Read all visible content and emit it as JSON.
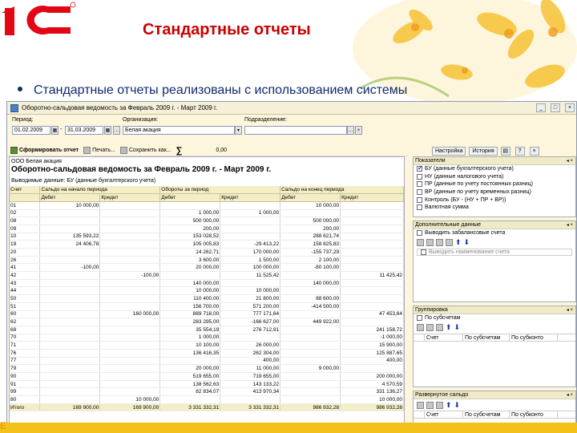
{
  "slide": {
    "title": "Стандартные отчеты",
    "bullet": "Стандартные отчеты реализованы с использованием системы",
    "bottom_letter": "E",
    "colors": {
      "title": "#cc0000",
      "bullet": "#102a6c",
      "logo": "#e30613"
    }
  },
  "window": {
    "title": "Оборотно-сальдовая ведомость за Февраль 2009 г. - Март 2009 г.",
    "period_label": "Период:",
    "date_from": "01.02.2009",
    "date_to": "31.03.2009",
    "org_label": "Организация:",
    "org_value": "Белая акация",
    "dept_label": "Подразделение:",
    "dept_value": ""
  },
  "toolbar": {
    "generate": "Сформировать отчет",
    "print": "Печать...",
    "save": "Сохранить как...",
    "sum_symbol": "∑",
    "sum_value": "0,00"
  },
  "right_toolbar": {
    "settings": "Настройка",
    "history": "История"
  },
  "report": {
    "org": "ООО Белая акация",
    "title": "Оборотно-сальдовая ведомость за Февраль 2009 г. - Март 2009 г.",
    "filter": "Выводимые данные:  БУ (данные бухгалтерского учета)",
    "headers": [
      "Счет",
      "Сальдо на начало периода",
      "Обороты за период",
      "Сальдо на конец периода"
    ],
    "subheaders": [
      "Дебет",
      "Кредит",
      "Дебет",
      "Кредит",
      "Дебет",
      "Кредит"
    ],
    "rows": [
      [
        "01",
        "10 000,00",
        "",
        "",
        "",
        "10 000,00",
        ""
      ],
      [
        "02",
        "",
        "",
        "1 000,00",
        "1 000,00",
        "",
        ""
      ],
      [
        "08",
        "",
        "",
        "500 000,00",
        "",
        "500 000,00",
        ""
      ],
      [
        "09",
        "",
        "",
        "200,00",
        "",
        "200,00",
        ""
      ],
      [
        "10",
        "135 593,22",
        "",
        "153 028,52",
        "",
        "288 621,74",
        ""
      ],
      [
        "19",
        "24 406,78",
        "",
        "105 005,83",
        "-29 413,22",
        "158 825,83",
        ""
      ],
      [
        "20",
        "",
        "",
        "14 262,71",
        "170 000,00",
        "-155 737,29",
        ""
      ],
      [
        "26",
        "",
        "",
        "3 600,00",
        "1 500,00",
        "2 100,00",
        ""
      ],
      [
        "41",
        "-100,00",
        "",
        "20 000,00",
        "100 000,00",
        "-80 100,00",
        ""
      ],
      [
        "42",
        "",
        "-100,00",
        "",
        "11 525,42",
        "",
        "11 425,42"
      ],
      [
        "43",
        "",
        "",
        "140 000,00",
        "",
        "140 000,00",
        ""
      ],
      [
        "44",
        "",
        "",
        "10 000,00",
        "10 000,00",
        "",
        ""
      ],
      [
        "50",
        "",
        "",
        "110 400,00",
        "21 800,00",
        "88 600,00",
        ""
      ],
      [
        "51",
        "",
        "",
        "156 700,00",
        "571 200,00",
        "-414 500,00",
        ""
      ],
      [
        "60",
        "",
        "160 000,00",
        "889 718,00",
        "777 171,64",
        "",
        "47 453,64"
      ],
      [
        "62",
        "",
        "",
        "283 295,00",
        "-166 627,00",
        "449 922,00",
        ""
      ],
      [
        "68",
        "",
        "",
        "35 554,19",
        "276 712,91",
        "",
        "241 158,72"
      ],
      [
        "70",
        "",
        "",
        "1 000,00",
        "",
        "",
        "-1 000,00"
      ],
      [
        "71",
        "",
        "",
        "10 100,00",
        "26 000,00",
        "",
        "15 900,00"
      ],
      [
        "76",
        "",
        "",
        "136 416,35",
        "262 304,00",
        "",
        "125 887,65"
      ],
      [
        "77",
        "",
        "",
        "",
        "400,00",
        "",
        "400,00"
      ],
      [
        "79",
        "",
        "",
        "20 000,00",
        "11 000,00",
        "9 000,00",
        ""
      ],
      [
        "90",
        "",
        "",
        "519 655,00",
        "719 655,00",
        "",
        "200 000,00"
      ],
      [
        "91",
        "",
        "",
        "138 562,63",
        "143 133,22",
        "",
        "4 570,59"
      ],
      [
        "99",
        "",
        "",
        "82 834,07",
        "413 970,34",
        "",
        "331 136,27"
      ],
      [
        "80",
        "",
        "10 000,00",
        "",
        "",
        "",
        "10 000,00"
      ]
    ],
    "total": [
      "Итого",
      "169 900,00",
      "169 900,00",
      "3 331 332,31",
      "3 331 332,31",
      "986 932,28",
      "986 932,28"
    ]
  },
  "panel": {
    "indicators": {
      "title": "Показатели",
      "items": [
        {
          "label": "БУ (данные бухгалтерского учета)",
          "checked": true
        },
        {
          "label": "НУ (данные налогового учета)",
          "checked": false
        },
        {
          "label": "ПР (данные по учету постоянных разниц)",
          "checked": false
        },
        {
          "label": "ВР (данные по учету временных разниц)",
          "checked": false
        },
        {
          "label": "Контроль (БУ - (НУ + ПР + ВР))",
          "checked": false
        },
        {
          "label": "Валютная сумма",
          "checked": false
        }
      ]
    },
    "extra": {
      "title": "Дополнительные данные",
      "offbalance": "Выводить забалансовые счета",
      "account_name": "Выводить наименование счета"
    },
    "grouping": {
      "title": "Группировка",
      "by_sub": "По субсчетам",
      "cols": [
        "Счет",
        "По субсчетам",
        "По субконто"
      ]
    },
    "expanded": {
      "title": "Развернутое сальдо",
      "cols": [
        "Счет",
        "По субсчетам",
        "По субконто"
      ]
    }
  }
}
